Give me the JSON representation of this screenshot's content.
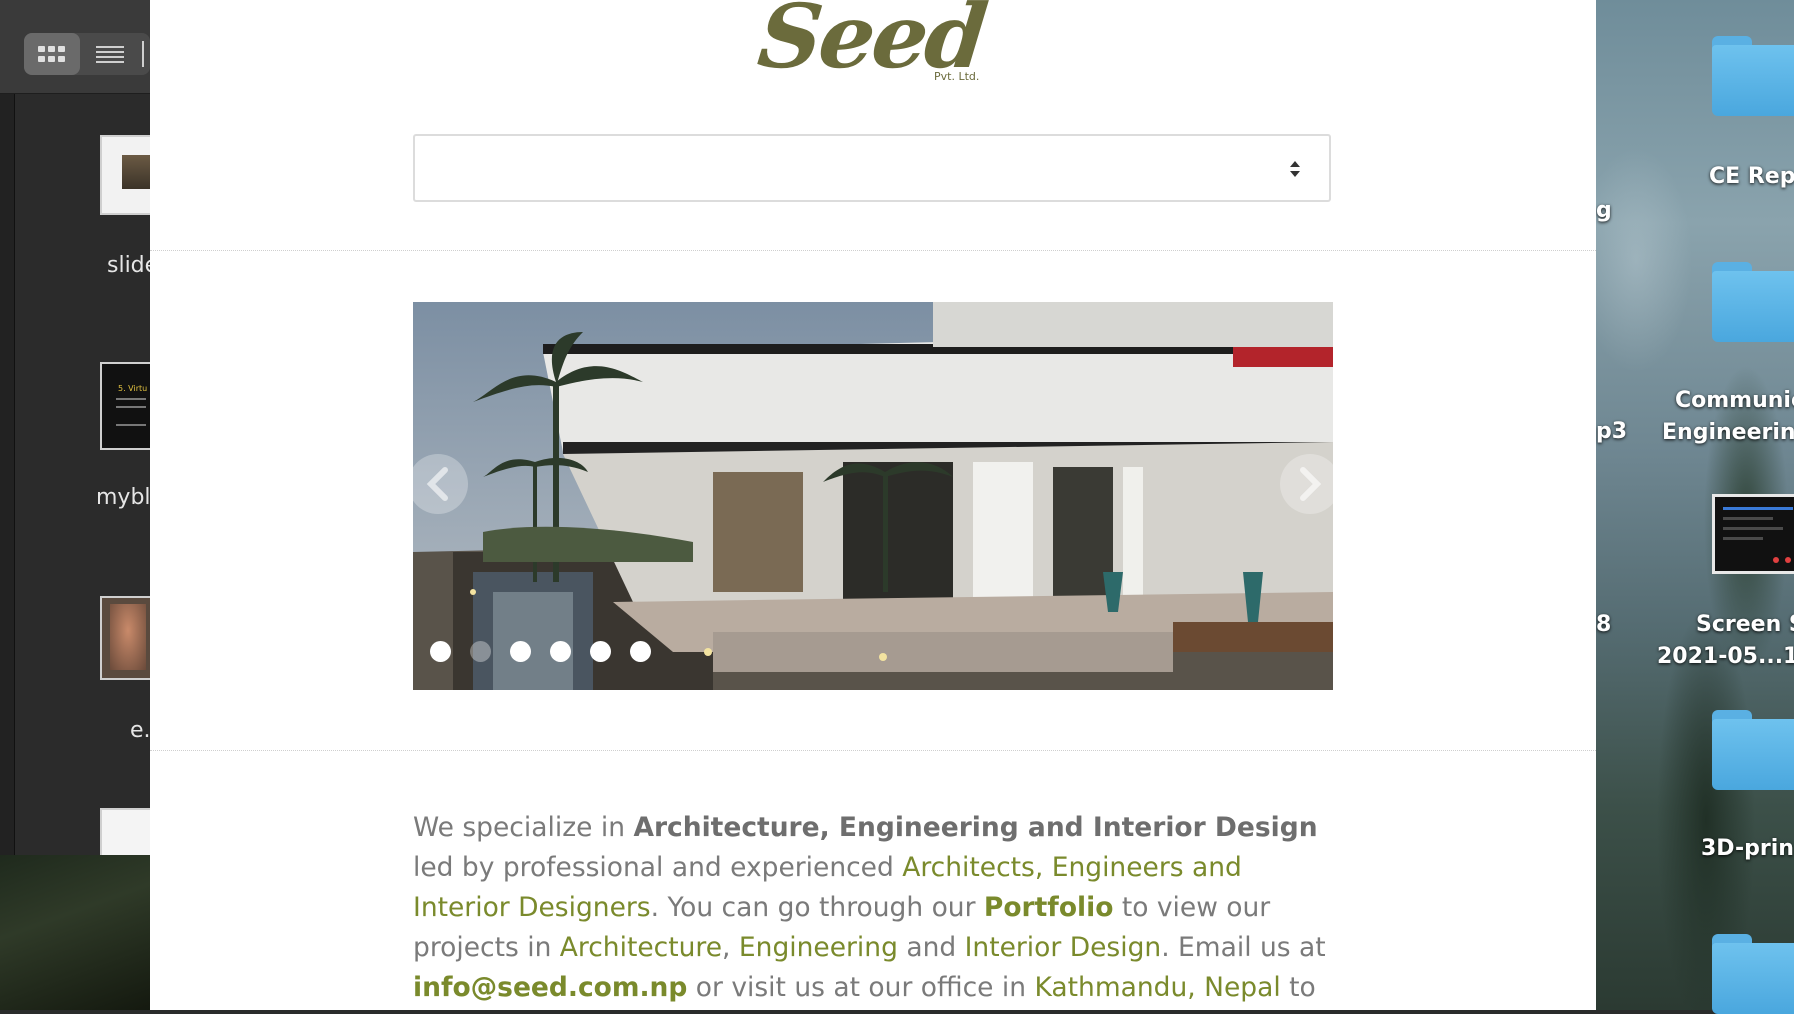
{
  "finder": {
    "view_modes": [
      "icon-view",
      "list-view"
    ],
    "files": [
      {
        "label": "slide"
      },
      {
        "label": "mybl",
        "thumb_heading": "5. Virtu"
      },
      {
        "label": "e."
      },
      {
        "label": ""
      }
    ]
  },
  "desktop": {
    "items": [
      {
        "label": "CE Rep"
      },
      {
        "label_line1": "Communic",
        "label_line2": "Engineerin"
      },
      {
        "label_line1": "Screen S",
        "label_line2": "2021-05...1"
      },
      {
        "label": "3D-prin"
      }
    ],
    "side_fragments": [
      "g",
      "p3",
      "8"
    ]
  },
  "site": {
    "logo_word": "Seed",
    "logo_sub": "Pvt. Ltd.",
    "select_value": "",
    "slider": {
      "slide_count": 6,
      "active_index": 1
    },
    "intro": {
      "p1": "We specialize in ",
      "b1": "Architecture, Engineering and Interior Design",
      "p2": " led by professional and experienced ",
      "l1": "Architects, Engineers and Interior Designers",
      "p3": ". You can go through our ",
      "l2": "Portfolio",
      "p4": " to view our projects in ",
      "l3": "Architecture",
      "p5": ", ",
      "l4": "Engineering",
      "p6": " and ",
      "l5": "Interior Design",
      "p7": ". Email us at ",
      "l6": "info@seed.com.np",
      "p8": " or visit us at our office in ",
      "l7": "Kathmandu, Nepal",
      "p9": " to discuss your project with our"
    },
    "colors": {
      "brand": "#6b6b3c",
      "link": "#7a8a2c",
      "body_text": "#7a7a7a"
    }
  }
}
